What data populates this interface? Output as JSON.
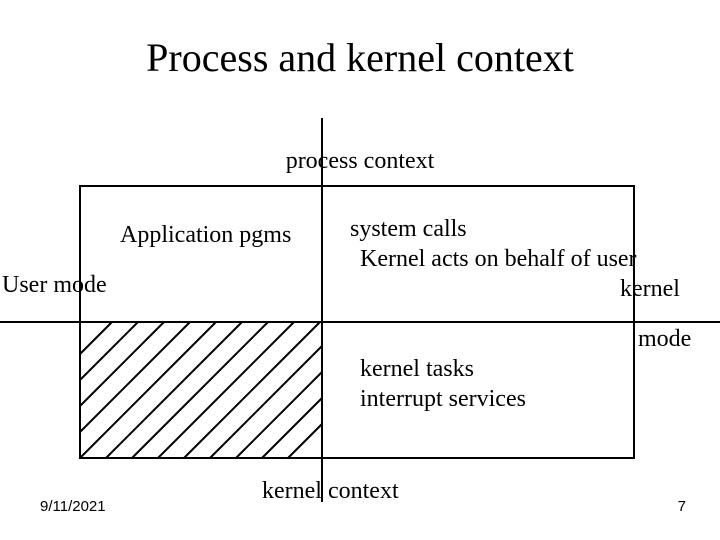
{
  "title": "Process and kernel context",
  "labels": {
    "process_context": "process context",
    "kernel_context": "kernel context",
    "application_pgms": "Application pgms",
    "system_calls": "system calls",
    "kernel_acts": "Kernel acts on behalf of user",
    "kernel_right": "kernel",
    "user_mode": "User mode",
    "mode": "mode",
    "kernel_tasks": "kernel tasks",
    "interrupt_services": "interrupt services"
  },
  "footer": {
    "date": "9/11/2021",
    "page_number": "7"
  }
}
